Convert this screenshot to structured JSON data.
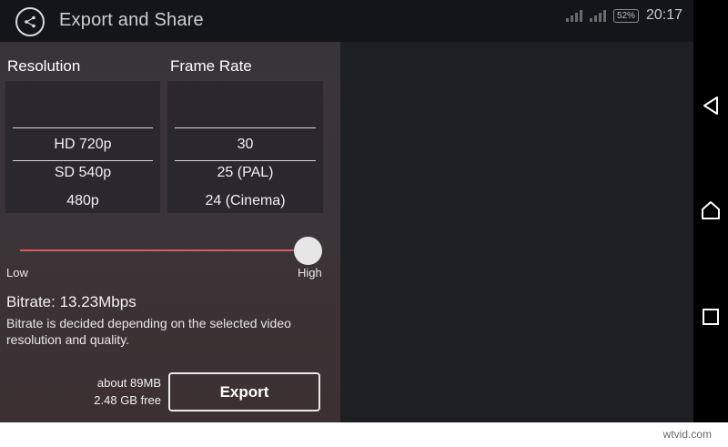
{
  "header": {
    "title": "Export and Share",
    "back_icon": "share-back-icon"
  },
  "status_bar": {
    "battery": "52%",
    "time": "20:17"
  },
  "resolution": {
    "title": "Resolution",
    "options": [
      "HD 720p",
      "SD 540p",
      "480p"
    ],
    "selected": "HD 720p"
  },
  "frame_rate": {
    "title": "Frame Rate",
    "options": [
      "30",
      "25 (PAL)",
      "24 (Cinema)"
    ],
    "selected": "30"
  },
  "quality": {
    "low_label": "Low",
    "high_label": "High",
    "level": 1.0,
    "track_color": "#d9585b"
  },
  "bitrate": {
    "label": "Bitrate: 13.23Mbps",
    "description": "Bitrate is decided depending on the selected video resolution and quality."
  },
  "export": {
    "size": "about 89MB",
    "free": "2.48 GB free",
    "button_label": "Export"
  },
  "nav": {
    "back_icon": "triangle-back-icon",
    "home_icon": "home-icon",
    "recents_icon": "recents-square-icon"
  },
  "watermark": "wtvid.com"
}
